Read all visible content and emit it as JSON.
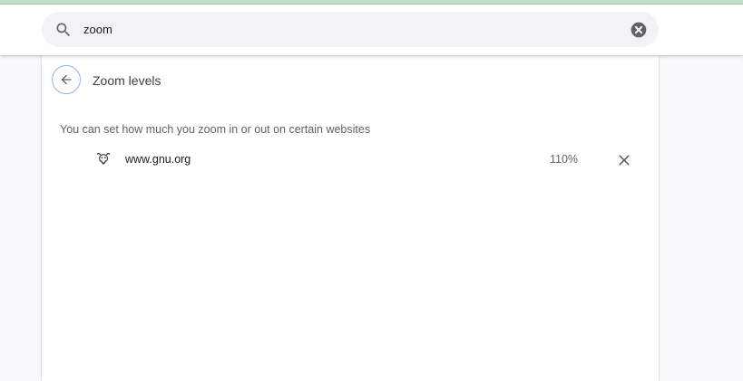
{
  "search": {
    "value": "zoom",
    "icon": "search-icon",
    "clear_icon": "clear-circle-icon"
  },
  "page": {
    "title": "Zoom levels",
    "back_icon": "arrow-back-icon",
    "description": "You can set how much you zoom in or out on certain websites"
  },
  "zoom_levels": [
    {
      "site": "www.gnu.org",
      "zoom": "110%",
      "favicon": "gnu-favicon",
      "remove_icon": "close-icon"
    }
  ],
  "colors": {
    "accent_top": "#c2e0c6",
    "back_button_ring": "#8ab4f8",
    "search_bg": "#f1f3f4"
  }
}
